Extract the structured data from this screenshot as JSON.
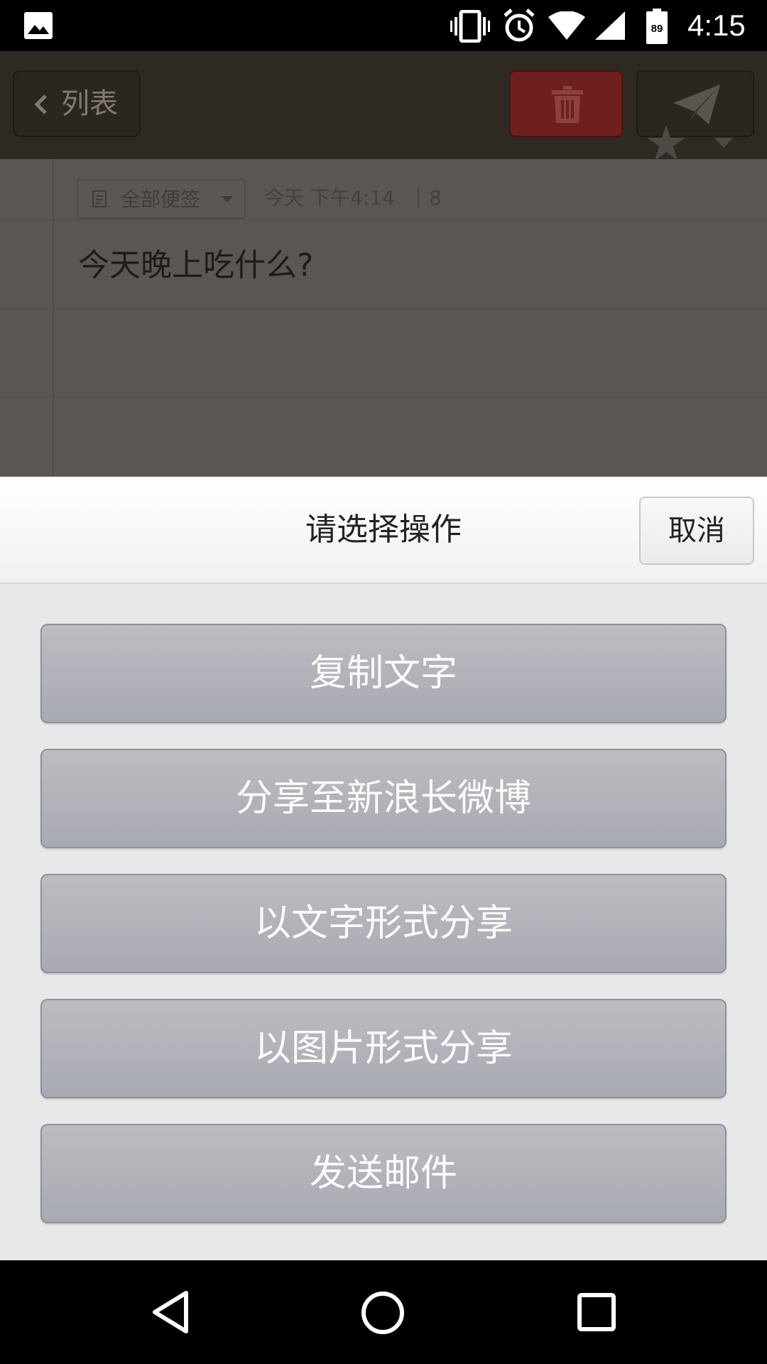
{
  "status_bar": {
    "time": "4:15",
    "battery": "89",
    "icons": [
      "gallery-icon",
      "vibrate-icon",
      "alarm-icon",
      "wifi-icon",
      "signal-icon",
      "battery-icon"
    ]
  },
  "toolbar": {
    "back_label": "列表",
    "icons": [
      "chevron-left-icon",
      "trash-icon",
      "send-icon"
    ],
    "delete_color": "#6f1f1d"
  },
  "note": {
    "category": "全部便签",
    "date": "今天 下午4:14",
    "char_count": "8",
    "text": "今天晚上吃什么?"
  },
  "sheet": {
    "title": "请选择操作",
    "cancel_label": "取消",
    "actions": [
      {
        "label": "复制文字"
      },
      {
        "label": "分享至新浪长微博"
      },
      {
        "label": "以文字形式分享"
      },
      {
        "label": "以图片形式分享"
      },
      {
        "label": "发送邮件"
      }
    ]
  },
  "nav_bar": {
    "icons": [
      "back-triangle-icon",
      "home-circle-icon",
      "recents-square-icon"
    ]
  }
}
